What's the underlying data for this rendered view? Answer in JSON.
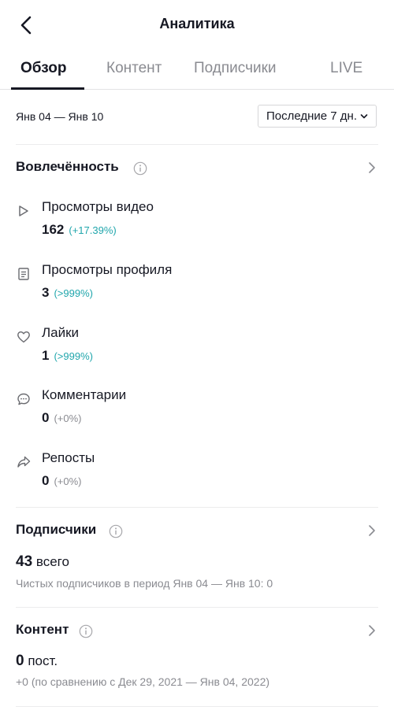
{
  "header": {
    "title": "Аналитика",
    "back_icon": "chevron-left-icon"
  },
  "tabs": [
    {
      "label": "Обзор",
      "active": true
    },
    {
      "label": "Контент",
      "active": false
    },
    {
      "label": "Подписчики",
      "active": false
    },
    {
      "label": "LIVE",
      "active": false
    }
  ],
  "date_range": "Янв 04 — Янв 10",
  "period_select": {
    "value": "Последние 7 дн."
  },
  "engagement": {
    "title": "Вовлечённость",
    "metrics": [
      {
        "icon": "play-icon",
        "label": "Просмотры видео",
        "value": "162",
        "change": "(+17.39%)",
        "change_type": "positive"
      },
      {
        "icon": "profile-doc-icon",
        "label": "Просмотры профиля",
        "value": "3",
        "change": "(>999%)",
        "change_type": "positive"
      },
      {
        "icon": "heart-icon",
        "label": "Лайки",
        "value": "1",
        "change": "(>999%)",
        "change_type": "positive"
      },
      {
        "icon": "comment-icon",
        "label": "Комментарии",
        "value": "0",
        "change": "(+0%)",
        "change_type": "neutral"
      },
      {
        "icon": "share-icon",
        "label": "Репосты",
        "value": "0",
        "change": "(+0%)",
        "change_type": "neutral"
      }
    ]
  },
  "followers": {
    "title": "Подписчики",
    "total_value": "43",
    "total_suffix": "всего",
    "net_text": "Чистых подписчиков в период Янв 04 — Янв 10: 0"
  },
  "content": {
    "title": "Контент",
    "posts_value": "0",
    "posts_suffix": "пост.",
    "compare_text": "+0 (по сравнению с Дек 29, 2021 — Янв 04, 2022)"
  },
  "colors": {
    "positive": "#20a6ac",
    "neutral": "#8a8b91",
    "text": "#161823"
  }
}
